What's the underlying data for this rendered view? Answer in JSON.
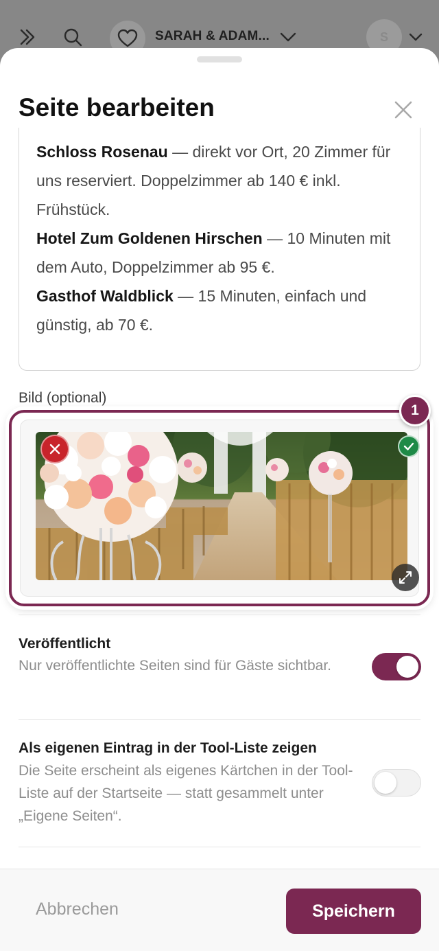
{
  "topbar": {
    "title": "SARAH & ADAM...",
    "avatar_letter": "S",
    "icons": [
      "double-chevron-right-icon",
      "search-icon",
      "heart-icon",
      "chevron-down-icon",
      "chevron-down-icon"
    ]
  },
  "sheet": {
    "title": "Seite bearbeiten",
    "close_icon": "close-icon",
    "content": {
      "paragraphs": [
        {
          "bold": "Schloss Rosenau",
          "text": " — direkt vor Ort, 20 Zimmer für uns reserviert. Doppelzimmer ab 140 € inkl. Frühstück."
        },
        {
          "bold": "Hotel Zum Goldenen Hirschen",
          "text": " — 10 Minuten mit dem Auto, Doppelzimmer ab 95 €."
        },
        {
          "bold": "Gasthof Waldblick",
          "text": " — 15 Minuten, einfach und günstig, ab 70 €."
        }
      ]
    },
    "image_field": {
      "label": "Bild (optional)",
      "badge_number": "1",
      "remove_icon": "close-icon",
      "selected_icon": "check-icon",
      "expand_icon": "expand-icon"
    },
    "settings": [
      {
        "title": "Veröffentlicht",
        "description": "Nur veröffentlichte Seiten sind für Gäste sichtbar.",
        "enabled": true
      },
      {
        "title": "Als eigenen Eintrag in der Tool-Liste zeigen",
        "description": "Die Seite erscheint als eigenes Kärtchen in der Tool-Liste auf der Startseite — statt gesammelt unter „Eigene Seiten“.",
        "enabled": false
      }
    ]
  },
  "footer": {
    "cancel_label": "Abbrechen",
    "save_label": "Speichern"
  },
  "colors": {
    "accent": "#7b2852",
    "danger": "#c8242b",
    "success": "#1e8a47"
  }
}
